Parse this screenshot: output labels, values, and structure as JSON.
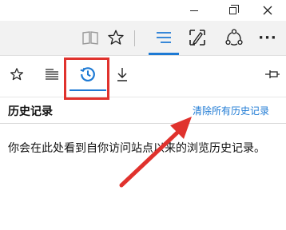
{
  "toolbar": {
    "icons": [
      "reading-view-icon",
      "favorite-star-icon",
      "hub-icon",
      "web-note-icon",
      "share-icon",
      "more-icon"
    ],
    "more_glyph": "···"
  },
  "hub_tabs": [
    "favorites-tab",
    "reading-list-tab",
    "history-tab",
    "downloads-tab",
    "pin-pane"
  ],
  "panel": {
    "title": "历史记录",
    "clear_link": "清除所有历史记录",
    "empty_message": "你会在此处看到自你访问站点以来的浏览历史记录。"
  },
  "colors": {
    "accent": "#1e7ad4",
    "annotation": "#e0322d"
  }
}
